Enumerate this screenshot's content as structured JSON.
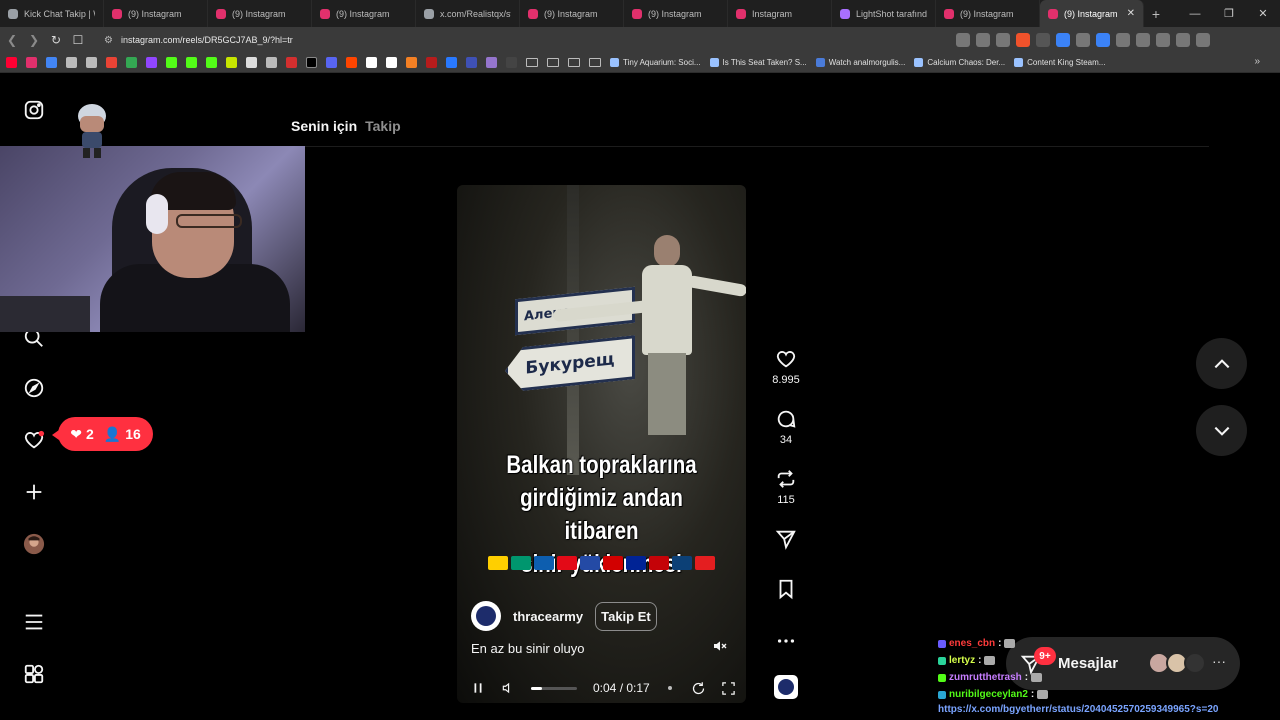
{
  "browser": {
    "tabs": [
      {
        "title": "Kick Chat Takip | Wi",
        "fav": "#9aa0a6",
        "active": false
      },
      {
        "title": "(9) Instagram",
        "fav": "#e1306c",
        "active": false
      },
      {
        "title": "(9) Instagram",
        "fav": "#e1306c",
        "active": false
      },
      {
        "title": "(9) Instagram",
        "fav": "#e1306c",
        "active": false
      },
      {
        "title": "x.com/Realistqx/sta",
        "fav": "#9aa0a6",
        "active": false
      },
      {
        "title": "(9) Instagram",
        "fav": "#e1306c",
        "active": false
      },
      {
        "title": "(9) Instagram",
        "fav": "#e1306c",
        "active": false
      },
      {
        "title": "Instagram",
        "fav": "#e1306c",
        "active": false
      },
      {
        "title": "LightShot tarafından",
        "fav": "#a970ff",
        "active": false
      },
      {
        "title": "(9) Instagram",
        "fav": "#e1306c",
        "active": false
      },
      {
        "title": "(9) Instagram",
        "fav": "#e1306c",
        "active": true
      }
    ],
    "url": "instagram.com/reels/DR5GCJ7AB_9/?hl=tr",
    "bookmarks": [
      {
        "label": "Tiny Aquarium: Soci...",
        "color": "#9ac2ff"
      },
      {
        "label": "Is This Seat Taken? S...",
        "color": "#9ac2ff"
      },
      {
        "label": "Watch analmorgulis...",
        "color": "#4a7bd9"
      },
      {
        "label": "Calcium Chaos: Der...",
        "color": "#9ac2ff"
      },
      {
        "label": "Content King Steam...",
        "color": "#9ac2ff"
      }
    ]
  },
  "feed": {
    "tab_for_you": "Senin için",
    "tab_following": "Takip"
  },
  "notifications": {
    "likes": "2",
    "followers": "16"
  },
  "reel": {
    "sign_top": "Алекс...",
    "sign_bottom": "Букурещ",
    "caption": [
      "Balkan topraklarına",
      "girdiğimiz andan itibaren",
      "sinir yüklenmesi"
    ],
    "author": "thracearmy",
    "follow_label": "Takip Et",
    "description": "En az bu sinir oluyo",
    "time_current": "0:04",
    "time_total": "0:17",
    "progress": 0.235,
    "flags": [
      "#ffcf00",
      "#00966e",
      "#0d5eaf",
      "#e30a17",
      "#244aa5",
      "#d20000",
      "#002395",
      "#c40308",
      "#0c4076",
      "#e41e20"
    ]
  },
  "actions": {
    "likes": "8.995",
    "comments": "34",
    "reposts": "115"
  },
  "messages": {
    "label": "Mesajlar",
    "badge": "9+"
  },
  "chat": [
    {
      "user": "enes_cbn",
      "color": "#ff3b3b",
      "badge": "#6a5cff",
      "text": ":"
    },
    {
      "user": "lertyz",
      "color": "#d6ff4a",
      "badge": "#2ad39a",
      "text": ":"
    },
    {
      "user": "zumrutthetrash",
      "color": "#c77dff",
      "badge": "#53fc18",
      "text": ":"
    },
    {
      "user": "nuribilgeceylan2",
      "color": "#53fc18",
      "badge": "#2aa7d3",
      "text": ":"
    }
  ],
  "chat_link": "https://x.com/bgyetherr/status/2040452570259349965?s=20"
}
